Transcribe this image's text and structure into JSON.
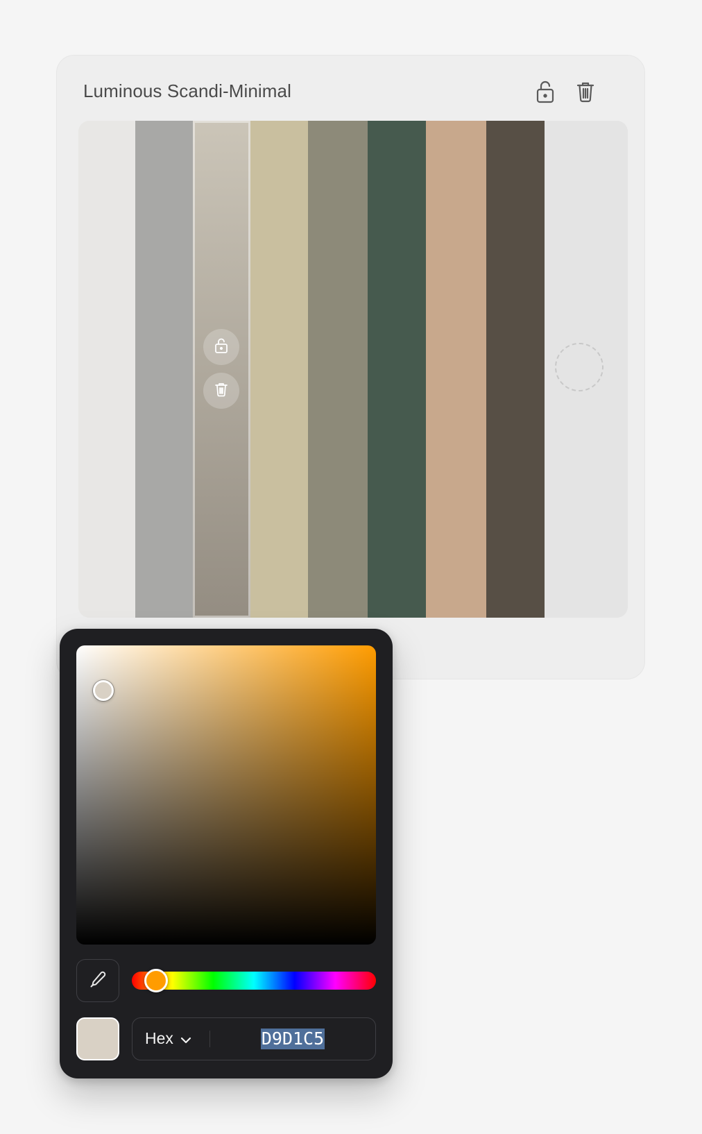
{
  "card": {
    "title": "Luminous Scandi-Minimal",
    "actions": {
      "lock_icon": "lock-open-icon",
      "delete_icon": "trash-icon"
    }
  },
  "palette": {
    "swatches": [
      {
        "color": "#e8e7e5"
      },
      {
        "color": "#a8a8a6"
      },
      {
        "color_top": "#cbc5b8",
        "color_bottom": "#948d82",
        "selected": true
      },
      {
        "color": "#c9bf9f"
      },
      {
        "color": "#8d8a79"
      },
      {
        "color": "#465a4e"
      },
      {
        "color": "#c8a88c"
      },
      {
        "color": "#574f45"
      }
    ],
    "add_slot_color": "#e4e4e4",
    "swatch_action_icons": [
      "lock-open-icon",
      "trash-icon"
    ]
  },
  "picker": {
    "hue_color": "#ff9c00",
    "hue_position": 0.1,
    "saturation": 0.09,
    "brightness": 0.85,
    "eyedropper_icon": "eyedropper-icon",
    "preview_color": "#d9d1c5",
    "format_label": "Hex",
    "format_chevron_icon": "chevron-down-icon",
    "hex_value": "D9D1C5"
  }
}
